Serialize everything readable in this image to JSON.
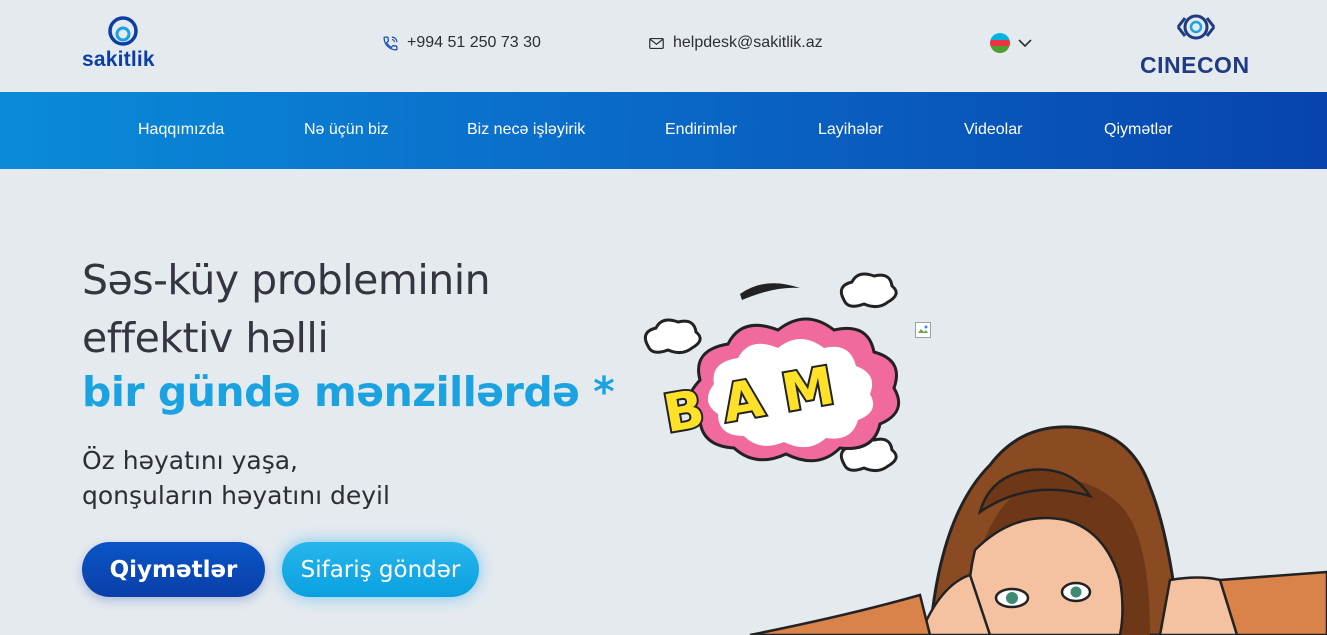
{
  "header": {
    "logo_text": "sakitlik",
    "phone": "+994 51 250 73 30",
    "email": "helpdesk@sakitlik.az",
    "language_flag": "azerbaijan-flag-icon",
    "partner_logo_text": "CINECON"
  },
  "nav": {
    "items": [
      {
        "label": "Haqqımızda"
      },
      {
        "label": "Nə üçün biz"
      },
      {
        "label": "Biz necə işləyirik"
      },
      {
        "label": "Endirimlər"
      },
      {
        "label": "Layihələr"
      },
      {
        "label": "Videolar"
      },
      {
        "label": "Qiymətlər"
      }
    ]
  },
  "hero": {
    "title_line1": "Səs-küy probleminin",
    "title_line2": "effektiv həlli",
    "title_highlight": "bir gündə mənzillərdə *",
    "subtitle_line1": "Öz həyatını yaşa,",
    "subtitle_line2": "qonşuların həyatını deyil",
    "primary_button": "Qiymətlər",
    "secondary_button": "Sifariş göndər",
    "illustration_text": "BAM"
  },
  "colors": {
    "nav_start": "#0a8bd8",
    "nav_end": "#0744ad",
    "highlight": "#1aa3e0",
    "primary_button": "#0a4bb8",
    "secondary_button": "#1aaae6",
    "background": "#e5eaef"
  }
}
